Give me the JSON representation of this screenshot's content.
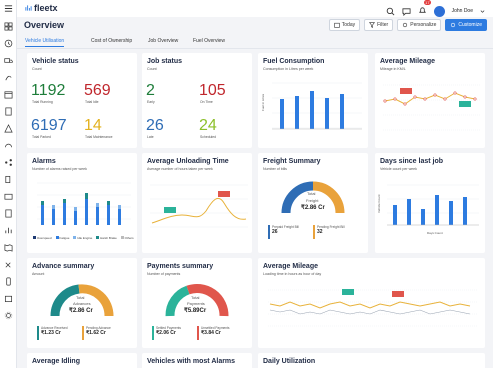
{
  "brand": "fleetx",
  "page": {
    "title": "Overview"
  },
  "user": {
    "name": "John Doe",
    "notifications": "17"
  },
  "actions": {
    "today": "Today",
    "filter": "Filter",
    "personalize": "Personalize",
    "customize": "Customize"
  },
  "tabs": [
    "Vehicle Utilisation",
    "Cost of Ownership",
    "Job Overview",
    "Fuel Overview"
  ],
  "vehicle_status": {
    "title": "Vehicle status",
    "subtitle": "Count",
    "stats": [
      {
        "value": "1192",
        "label": "Total Running",
        "color": "#1e7d3a"
      },
      {
        "value": "569",
        "label": "Total Idle",
        "color": "#c0272d"
      },
      {
        "value": "6197",
        "label": "Total Parked",
        "color": "#2f6db5"
      },
      {
        "value": "14",
        "label": "Total Maintenance",
        "color": "#e3b21f"
      }
    ]
  },
  "job_status": {
    "title": "Job status",
    "subtitle": "Count",
    "stats": [
      {
        "value": "2",
        "label": "Early",
        "color": "#1e7d3a"
      },
      {
        "value": "105",
        "label": "On Time",
        "color": "#c0272d"
      },
      {
        "value": "26",
        "label": "Late",
        "color": "#2f6db5"
      },
      {
        "value": "24",
        "label": "Scheduled",
        "color": "#8cbf2a"
      }
    ]
  },
  "fuel_consumption": {
    "title": "Fuel Consumption",
    "subtitle": "Consumption in Litres per week",
    "ylabel": "Fuel in Litres"
  },
  "average_mileage_top": {
    "title": "Average Mileage",
    "subtitle": "Mileage in KM/L"
  },
  "alarms": {
    "title": "Alarms",
    "subtitle": "Number of alarms raised per week",
    "legend": [
      "Overspeed",
      "Fatigue",
      "Idle Engine",
      "Harsh Brake",
      "Others"
    ]
  },
  "unloading": {
    "title": "Average Unloading Time",
    "subtitle": "Average number of hours taken per week"
  },
  "freight": {
    "title": "Freight Summary",
    "subtitle": "Number of bills",
    "center_label": "Total",
    "center_label2": "Freight",
    "center_value": "₹2.86 Cr",
    "items": [
      {
        "label": "Prepaid Freight Bill",
        "value": "26",
        "color": "#2f6db5"
      },
      {
        "label": "Pending Freight Bill",
        "value": "32",
        "color": "#e9a23b"
      }
    ]
  },
  "days_since_job": {
    "title": "Days since last job",
    "subtitle": "Vehicle count per week",
    "ylabel": "Vehicle Count",
    "xlabel": "Days Count"
  },
  "advance": {
    "title": "Advance summary",
    "subtitle": "Amount",
    "center_label": "Total",
    "center_label2": "Advances",
    "center_value": "₹2.86 Cr",
    "items": [
      {
        "label": "Advance Received",
        "value": "₹1.23 Cr",
        "color": "#1e8a8a"
      },
      {
        "label": "Pending Advance",
        "value": "₹1.62 Cr",
        "color": "#e9a23b"
      }
    ]
  },
  "payments": {
    "title": "Payments summary",
    "subtitle": "Number of payments",
    "center_label": "Total",
    "center_label2": "Payments",
    "center_value": "₹5.89Cr",
    "items": [
      {
        "label": "Settled Payments",
        "value": "₹2.06 Cr",
        "color": "#2bb39a"
      },
      {
        "label": "Unsettled Payments",
        "value": "₹3.84 Cr",
        "color": "#e0564c"
      }
    ]
  },
  "average_mileage_wide": {
    "title": "Average Mileage",
    "subtitle": "Loading time in hours as hour of day"
  },
  "bottom_cards": [
    "Average Idling",
    "Vehicles with most Alarms",
    "Daily Utilization"
  ],
  "colors": {
    "accent": "#2d7be0",
    "card": "#ffffff",
    "bg": "#f3f4f7"
  }
}
